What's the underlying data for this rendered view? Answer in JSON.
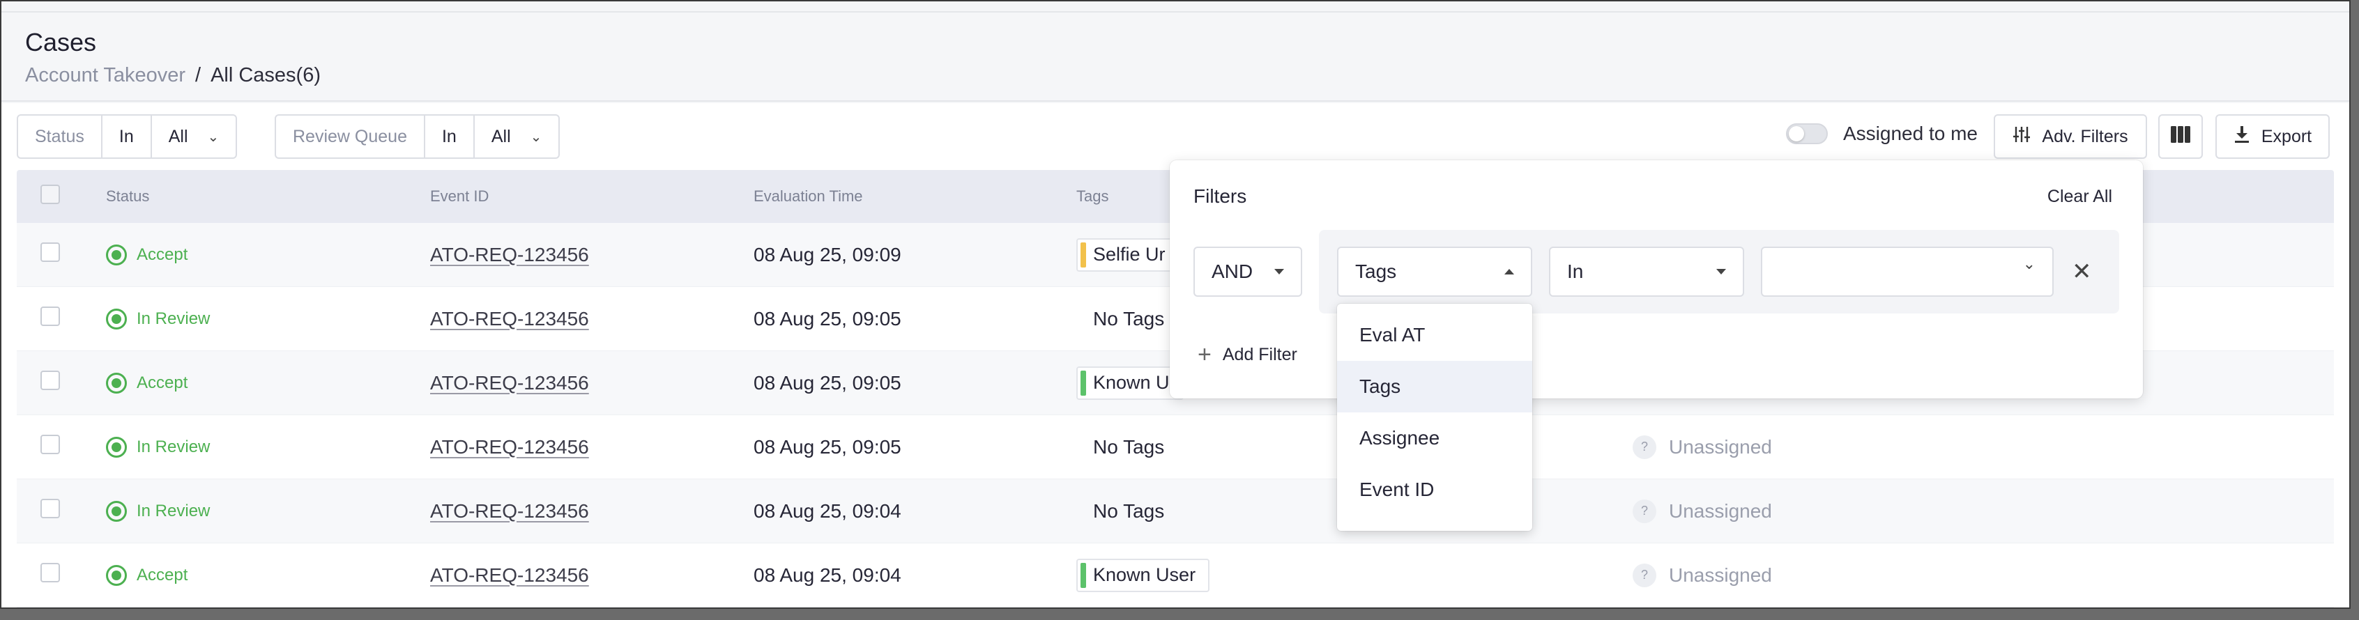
{
  "header": {
    "title": "Cases",
    "breadcrumb": {
      "parent": "Account Takeover",
      "separator": "/",
      "current": "All Cases(6)"
    }
  },
  "toolbar": {
    "status_filter": {
      "label": "Status",
      "operator": "In",
      "value": "All"
    },
    "queue_filter": {
      "label": "Review Queue",
      "operator": "In",
      "value": "All"
    },
    "assigned_to_me": {
      "label": "Assigned to me",
      "on": false
    },
    "adv_filters_label": "Adv. Filters",
    "export_label": "Export"
  },
  "table": {
    "columns": [
      "Status",
      "Event ID",
      "Evaluation Time",
      "Tags"
    ],
    "rows": [
      {
        "status": "Accept",
        "event_id": "ATO-REQ-123456",
        "time": "08 Aug 25, 09:09",
        "tag": "Selfie Ur",
        "tag_color": "#f2c14b",
        "assignee": ""
      },
      {
        "status": "In Review",
        "event_id": "ATO-REQ-123456",
        "time": "08 Aug 25, 09:05",
        "tag": "No Tags",
        "tag_color": "",
        "assignee": ""
      },
      {
        "status": "Accept",
        "event_id": "ATO-REQ-123456",
        "time": "08 Aug 25, 09:05",
        "tag": "Known U",
        "tag_color": "#5cc26a",
        "assignee": ""
      },
      {
        "status": "In Review",
        "event_id": "ATO-REQ-123456",
        "time": "08 Aug 25, 09:05",
        "tag": "No Tags",
        "tag_color": "",
        "assignee": "Unassigned"
      },
      {
        "status": "In Review",
        "event_id": "ATO-REQ-123456",
        "time": "08 Aug 25, 09:04",
        "tag": "No Tags",
        "tag_color": "",
        "assignee": "Unassigned"
      },
      {
        "status": "Accept",
        "event_id": "ATO-REQ-123456",
        "time": "08 Aug 25, 09:04",
        "tag": "Known User",
        "tag_color": "#5cc26a",
        "assignee": "Unassigned"
      }
    ]
  },
  "filters_panel": {
    "title": "Filters",
    "clear_all": "Clear All",
    "conjunction": "AND",
    "field": "Tags",
    "operator": "In",
    "value_placeholder": "",
    "add_filter": "Add Filter",
    "field_options": [
      "Eval AT",
      "Tags",
      "Assignee",
      "Event ID"
    ],
    "selected_option": "Tags"
  },
  "icons": {
    "adv_filters": "sliders-icon",
    "columns": "columns-icon",
    "export": "download-icon"
  },
  "colors": {
    "accent_green": "#4cb050",
    "header_bg": "#e8eaf2"
  }
}
